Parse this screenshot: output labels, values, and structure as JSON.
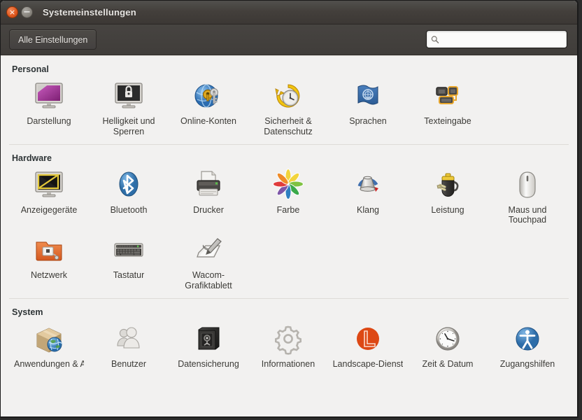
{
  "window": {
    "title": "Systemeinstellungen",
    "close_icon": "close-icon",
    "minimize_icon": "minimize-icon",
    "close_glyph": "×",
    "minimize_glyph": "−"
  },
  "toolbar": {
    "all_settings_label": "Alle Einstellungen",
    "search_placeholder": "",
    "search_value": "",
    "search_icon": "search-icon"
  },
  "colors": {
    "titlebar": "#433f3b",
    "toolbar": "#444140",
    "content_bg": "#f2f1f0",
    "label_text": "#3c3b37",
    "header_text": "#2e3436",
    "accent_orange": "#e25a20",
    "accent_blue": "#3465a4"
  },
  "sections": [
    {
      "title": "Personal",
      "items": [
        {
          "label": "Darstellung",
          "icon": "appearance-icon"
        },
        {
          "label": "Helligkeit und Sperren",
          "icon": "brightness-lock-icon"
        },
        {
          "label": "Online-Konten",
          "icon": "online-accounts-icon"
        },
        {
          "label": "Sicherheit & Datenschutz",
          "icon": "security-privacy-icon"
        },
        {
          "label": "Sprachen",
          "icon": "language-icon"
        },
        {
          "label": "Texteingabe",
          "icon": "text-entry-icon"
        }
      ]
    },
    {
      "title": "Hardware",
      "items": [
        {
          "label": "Anzeigegeräte",
          "icon": "displays-icon"
        },
        {
          "label": "Bluetooth",
          "icon": "bluetooth-icon"
        },
        {
          "label": "Drucker",
          "icon": "printer-icon"
        },
        {
          "label": "Farbe",
          "icon": "color-icon"
        },
        {
          "label": "Klang",
          "icon": "sound-icon"
        },
        {
          "label": "Leistung",
          "icon": "power-icon"
        },
        {
          "label": "Maus und Touchpad",
          "icon": "mouse-touchpad-icon"
        },
        {
          "label": "Netzwerk",
          "icon": "network-icon"
        },
        {
          "label": "Tastatur",
          "icon": "keyboard-icon"
        },
        {
          "label": "Wacom-Grafiktablett",
          "icon": "wacom-tablet-icon"
        }
      ]
    },
    {
      "title": "System",
      "items": [
        {
          "label": "Anwendungen & Aktualisierung",
          "icon": "software-updates-icon",
          "clipped": true
        },
        {
          "label": "Benutzer",
          "icon": "users-icon"
        },
        {
          "label": "Datensicherung",
          "icon": "backup-icon",
          "clipped": true
        },
        {
          "label": "Informationen",
          "icon": "details-icon"
        },
        {
          "label": "Landscape-Dienst",
          "icon": "landscape-icon"
        },
        {
          "label": "Zeit & Datum",
          "icon": "time-date-icon"
        },
        {
          "label": "Zugangshilfen",
          "icon": "accessibility-icon"
        }
      ]
    }
  ]
}
